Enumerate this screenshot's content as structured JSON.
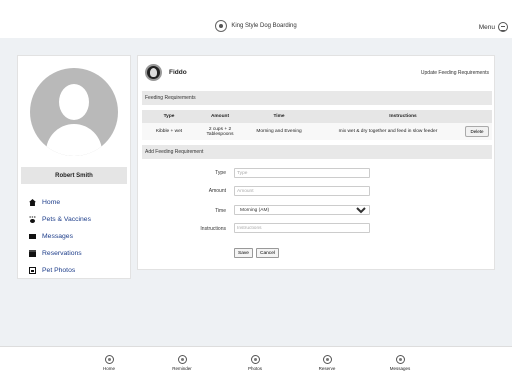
{
  "header": {
    "title": "King Style Dog Boarding",
    "menu_label": "Menu"
  },
  "user": {
    "name": "Robert Smith"
  },
  "sidebar": {
    "items": [
      {
        "label": "Home",
        "icon": "home-icon"
      },
      {
        "label": "Pets & Vaccines",
        "icon": "paw-icon"
      },
      {
        "label": "Messages",
        "icon": "mail-icon"
      },
      {
        "label": "Reservations",
        "icon": "calendar-icon"
      },
      {
        "label": "Pet Photos",
        "icon": "photo-icon"
      }
    ]
  },
  "pet": {
    "name": "Fiddo",
    "update_link": "Update Feeding Requirements"
  },
  "feeding": {
    "section_title": "Feeding Requirements",
    "columns": [
      "Type",
      "Amount",
      "Time",
      "Instructions"
    ],
    "rows": [
      {
        "type": "Kibble + wet",
        "amount": "2 cups + 2 Tablespoons",
        "time": "Morning and Evening",
        "instructions": "mix wet & dry together and feed in slow feeder",
        "action": "Delete"
      }
    ]
  },
  "add_form": {
    "section_title": "Add Feeding Requirement",
    "type_label": "Type",
    "type_placeholder": "Type",
    "amount_label": "Amount",
    "amount_placeholder": "Amount",
    "time_label": "Time",
    "time_value": "Morning (AM)",
    "instructions_label": "Instructions",
    "instructions_placeholder": "Instructions",
    "save_label": "Save",
    "cancel_label": "Cancel"
  },
  "bottom_nav": [
    {
      "label": "Home",
      "icon": "home-icon"
    },
    {
      "label": "Reminder",
      "icon": "reminder-icon"
    },
    {
      "label": "Photos",
      "icon": "photos-icon"
    },
    {
      "label": "Reserve",
      "icon": "reserve-icon"
    },
    {
      "label": "Messages",
      "icon": "messages-icon"
    }
  ],
  "colors": {
    "background": "#eef1f4",
    "nav_link": "#1d3d8a",
    "section_bar": "#e8e8e8"
  }
}
